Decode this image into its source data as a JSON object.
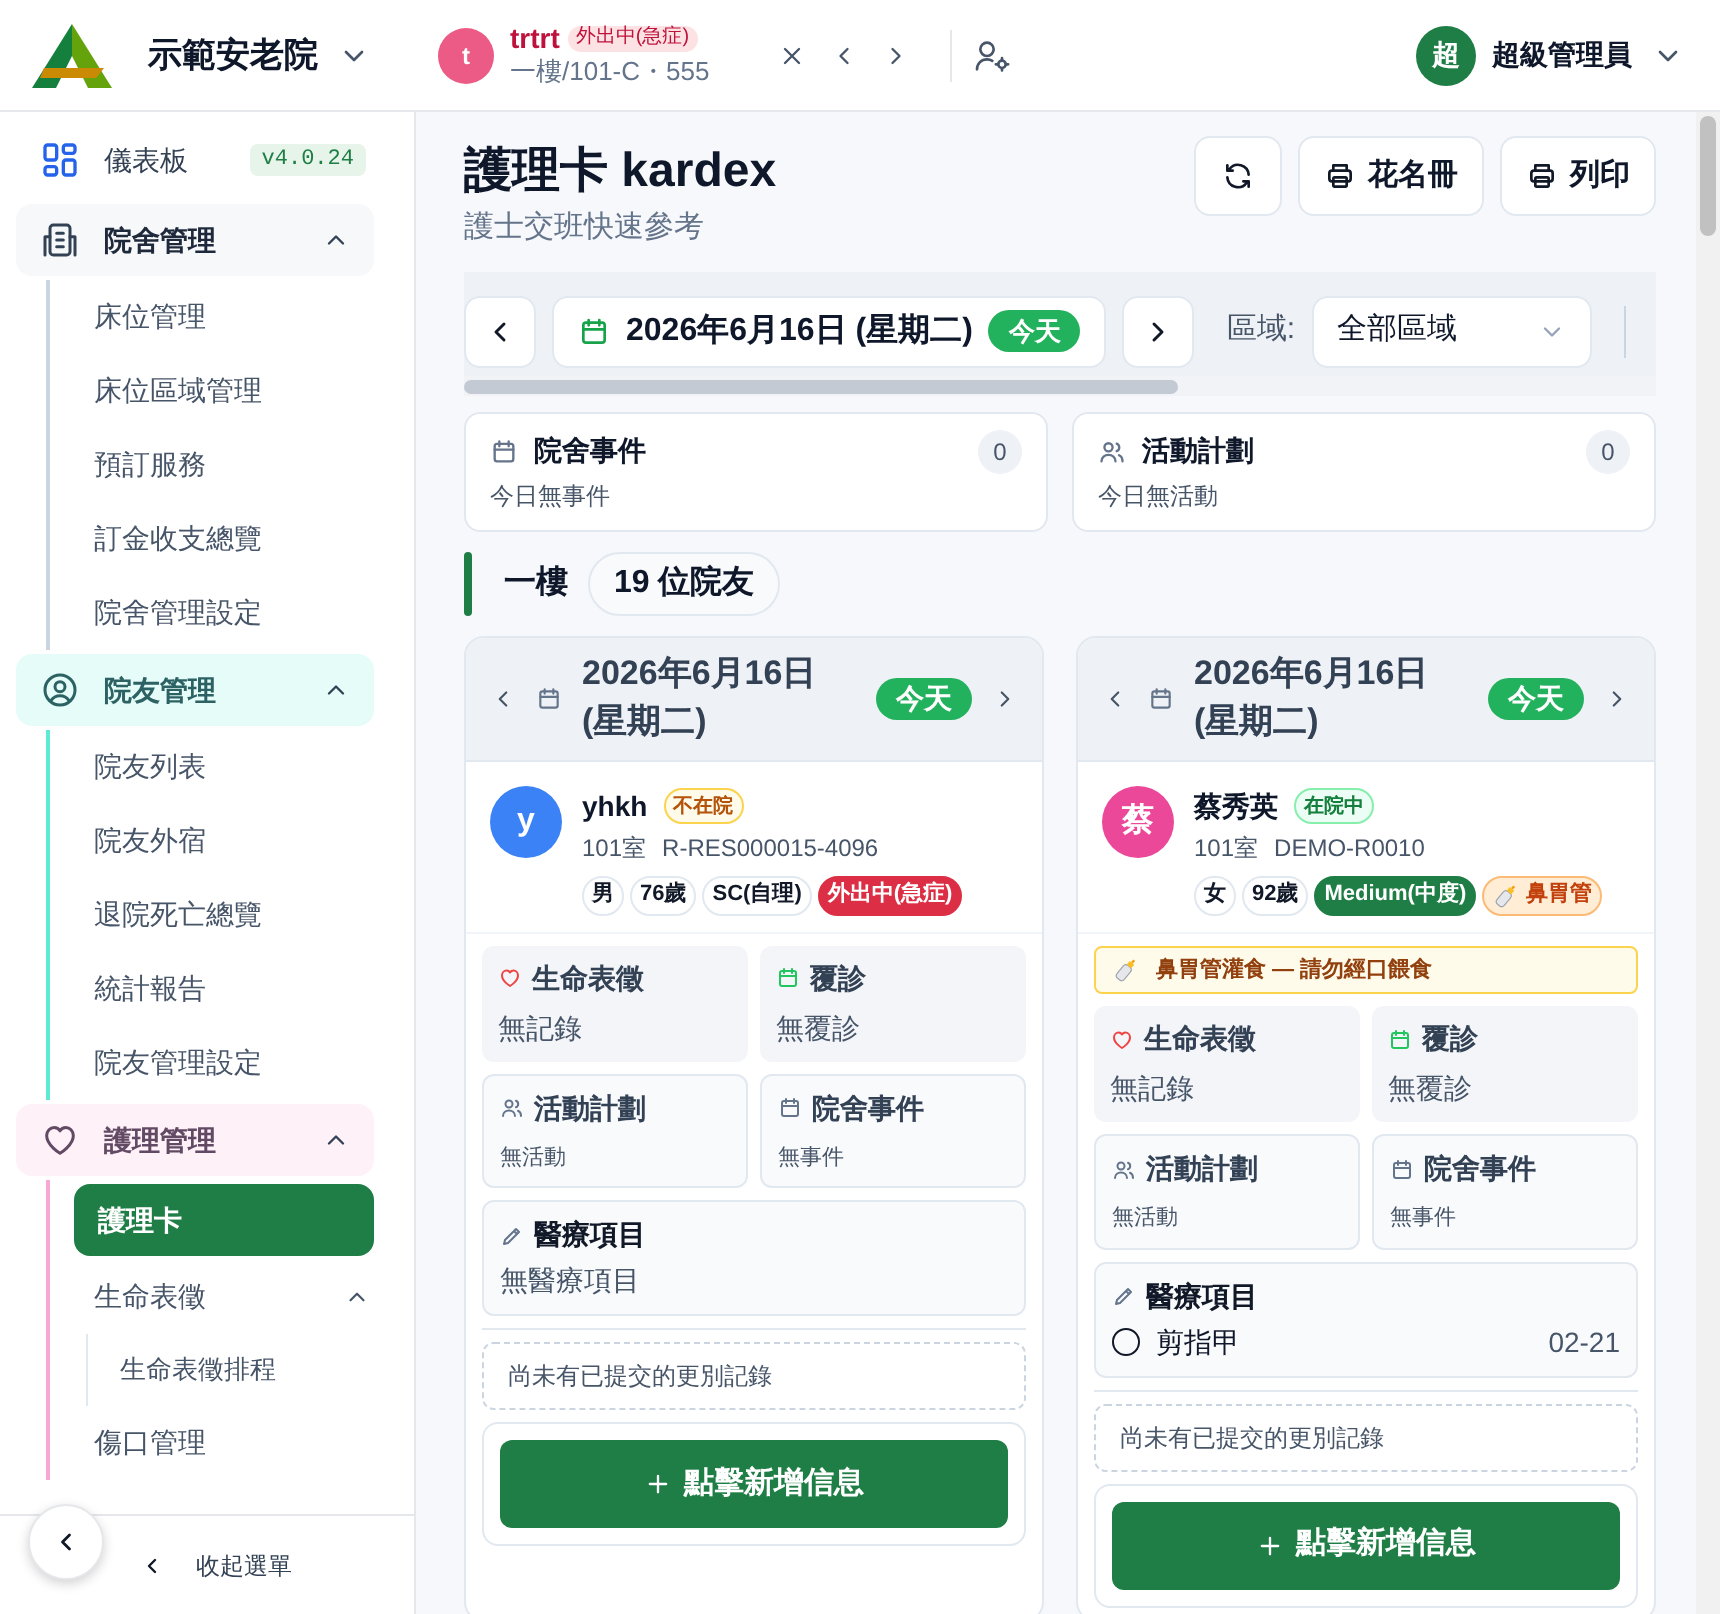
{
  "header": {
    "brand": "示範安老院",
    "patient": {
      "initial": "t",
      "name": "trtrt",
      "status": "外出中(急症)",
      "location": "一樓/101-C・555"
    },
    "user": {
      "initial": "超",
      "name": "超級管理員"
    }
  },
  "sidebar": {
    "items": [
      {
        "kind": "link",
        "label": "儀表板",
        "badge": "v4.0.24",
        "selected": false
      },
      {
        "kind": "group",
        "label": "院舍管理",
        "expanded": true,
        "color": "#cbd5e1",
        "children": [
          {
            "label": "床位管理",
            "selected": false
          },
          {
            "label": "床位區域管理",
            "selected": false
          },
          {
            "label": "預訂服務",
            "selected": false
          },
          {
            "label": "訂金收支總覽",
            "selected": false
          },
          {
            "label": "院舍管理設定",
            "selected": false
          }
        ]
      },
      {
        "kind": "group",
        "label": "院友管理",
        "expanded": true,
        "color": "#5eead4",
        "children": [
          {
            "label": "院友列表",
            "selected": false
          },
          {
            "label": "院友外宿",
            "selected": false
          },
          {
            "label": "退院死亡總覽",
            "selected": false
          },
          {
            "label": "統計報告",
            "selected": false
          },
          {
            "label": "院友管理設定",
            "selected": false
          }
        ]
      },
      {
        "kind": "group",
        "label": "護理管理",
        "expanded": true,
        "color": "#f9a8d4",
        "children": [
          {
            "label": "護理卡",
            "selected": true
          },
          {
            "label": "生命表徵",
            "selected": false,
            "expanded": true,
            "children": [
              {
                "label": "生命表徵排程",
                "selected": false
              }
            ]
          },
          {
            "label": "傷口管理",
            "selected": false
          }
        ]
      }
    ],
    "collapse_label": "收起選單"
  },
  "page": {
    "title": "護理卡 kardex",
    "subtitle": "護士交班快速參考",
    "actions": [
      {
        "kind": "refresh"
      },
      {
        "kind": "print",
        "label": "花名冊"
      },
      {
        "kind": "print",
        "label": "列印"
      }
    ]
  },
  "toolbar": {
    "date": "2026年6月16日 (星期二)",
    "today": "今天",
    "area_label": "區域:",
    "area_value": "全部區域"
  },
  "summary": [
    {
      "kind": "event",
      "title": "院舍事件",
      "count": "0",
      "note": "今日無事件"
    },
    {
      "kind": "activity",
      "title": "活動計劃",
      "count": "0",
      "note": "今日無活動"
    }
  ],
  "section": {
    "floor": "一樓",
    "count": "19 位院友"
  },
  "residents": [
    {
      "date": "2026年6月16日 (星期二)",
      "today": "今天",
      "initial": "y",
      "color": "#3b82f6",
      "name": "yhkh",
      "presence": {
        "kind": "away",
        "label": "不在院"
      },
      "room": "101室",
      "id": "R-RES000015-4096",
      "tags": [
        {
          "kind": "plain",
          "label": "男"
        },
        {
          "kind": "plain",
          "label": "76歲"
        },
        {
          "kind": "plain",
          "label": "SC(自理)"
        },
        {
          "kind": "danger",
          "label": "外出中(急症)"
        }
      ],
      "panels": [
        {
          "kind": "vitals",
          "title": "生命表徵",
          "value": "無記錄"
        },
        {
          "kind": "followup",
          "title": "覆診",
          "value": "無覆診"
        },
        {
          "kind": "activity",
          "title": "活動計劃",
          "value": "無活動"
        },
        {
          "kind": "event",
          "title": "院舍事件",
          "value": "無事件"
        }
      ],
      "medical": {
        "title": "醫療項目",
        "empty": "無醫療項目"
      },
      "shift_note": "尚未有已提交的更別記錄",
      "add_label": "點擊新增信息"
    },
    {
      "date": "2026年6月16日 (星期二)",
      "today": "今天",
      "initial": "蔡",
      "color": "#ec4899",
      "name": "蔡秀英",
      "presence": {
        "kind": "in",
        "label": "在院中"
      },
      "room": "101室",
      "id": "DEMO-R0010",
      "tags": [
        {
          "kind": "plain",
          "label": "女"
        },
        {
          "kind": "plain",
          "label": "92歲"
        },
        {
          "kind": "success",
          "label": "Medium(中度)"
        },
        {
          "kind": "tube",
          "label": "鼻胃管"
        }
      ],
      "alert": "鼻胃管灌食 — 請勿經口餵食",
      "panels": [
        {
          "kind": "vitals",
          "title": "生命表徵",
          "value": "無記錄"
        },
        {
          "kind": "followup",
          "title": "覆診",
          "value": "無覆診"
        },
        {
          "kind": "activity",
          "title": "活動計劃",
          "value": "無活動"
        },
        {
          "kind": "event",
          "title": "院舍事件",
          "value": "無事件"
        }
      ],
      "medical": {
        "title": "醫療項目",
        "items": [
          {
            "label": "剪指甲",
            "date": "02-21",
            "checked": false
          }
        ]
      },
      "shift_note": "尚未有已提交的更別記錄",
      "add_label": "點擊新增信息"
    }
  ]
}
